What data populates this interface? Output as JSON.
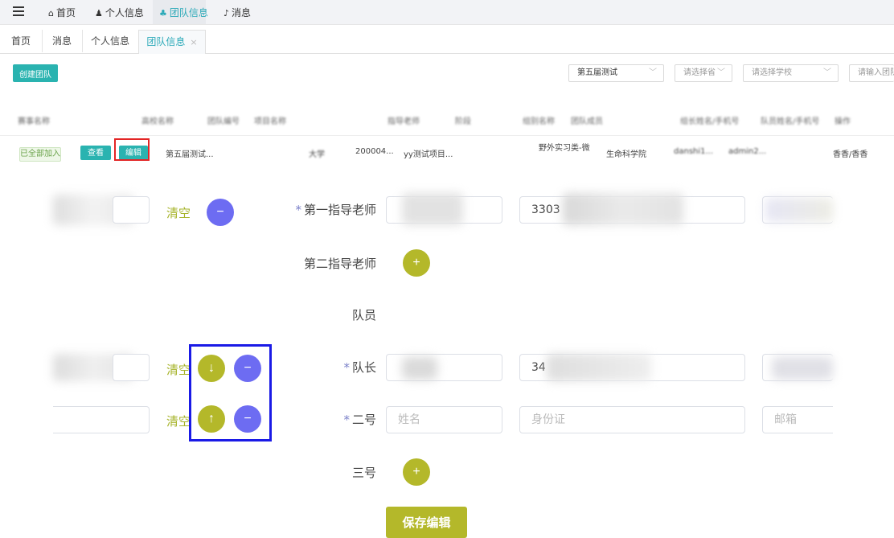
{
  "topnav": {
    "items": [
      {
        "icon": "⌂",
        "label": "首页"
      },
      {
        "icon": "♟",
        "label": "个人信息"
      },
      {
        "icon": "♣",
        "label": "团队信息"
      },
      {
        "icon": "♪",
        "label": "消息"
      }
    ]
  },
  "tabs": [
    {
      "label": "首页"
    },
    {
      "label": "消息"
    },
    {
      "label": "个人信息"
    },
    {
      "label": "团队信息",
      "close": "×"
    }
  ],
  "toolbar": {
    "create_label": "创建团队",
    "competition_value": "第五届测试",
    "province_placeholder": "请选择省",
    "school_placeholder": "请选择学校",
    "team_placeholder": "请输入团队"
  },
  "table": {
    "headers": [
      "赛事名称",
      "高校名称",
      "团队编号",
      "项目名称",
      "指导老师",
      "阶段",
      "组别名称",
      "团队成员",
      "组长姓名/手机号",
      "队员姓名/手机号",
      "操作"
    ],
    "row": {
      "status": "已全部加入",
      "view_label": "查看",
      "edit_label": "编辑",
      "competition": "第五届测试...",
      "school": "大学",
      "team_no": "200004...",
      "project": "yy测试项目...",
      "category": "野外实习类-微",
      "college": "生命科学院",
      "leader": "danshi1...",
      "member": "admin2...",
      "extra": "香香/香香"
    }
  },
  "form": {
    "clear_label": "清空",
    "first_teacher_label": "第一指导老师",
    "first_teacher_id": "3303",
    "second_teacher_label": "第二指导老师",
    "members_label": "队员",
    "leader_label": "队长",
    "leader_id": "34",
    "second_label": "二号",
    "name_placeholder": "姓名",
    "id_placeholder": "身份证",
    "email_placeholder": "邮箱",
    "third_label": "三号",
    "save_label": "保存编辑"
  },
  "icons": {
    "menu": "menu-icon",
    "plus": "+",
    "minus": "−",
    "down": "↓",
    "up": "↑",
    "chevron": "﹀"
  },
  "colors": {
    "accent": "#2ab3b0",
    "olive": "#b4b82a",
    "purple": "#6d6cf2",
    "highlight_red": "#e32525",
    "highlight_blue": "#1a1ae6"
  }
}
